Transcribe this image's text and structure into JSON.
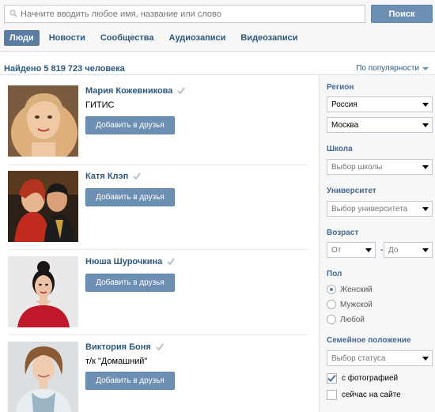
{
  "search": {
    "placeholder": "Начните вводить любое имя, название или слово",
    "button_label": "Поиск"
  },
  "tabs": [
    {
      "label": "Люди",
      "active": true
    },
    {
      "label": "Новости",
      "active": false
    },
    {
      "label": "Сообщества",
      "active": false
    },
    {
      "label": "Аудиозаписи",
      "active": false
    },
    {
      "label": "Видеозаписи",
      "active": false
    }
  ],
  "results_header": {
    "found": "Найдено 5 819 723 человека",
    "sort_label": "По популярности"
  },
  "people": [
    {
      "name": "Мария Кожевникова",
      "subtitle": "ГИТИС",
      "button": "Добавить в друзья"
    },
    {
      "name": "Катя Клэп",
      "subtitle": "",
      "button": "Добавить в друзья"
    },
    {
      "name": "Нюша Шурочкина",
      "subtitle": "",
      "button": "Добавить в друзья"
    },
    {
      "name": "Виктория Боня",
      "subtitle": "т/к \"Домашний\"",
      "button": "Добавить в друзья"
    }
  ],
  "filters": {
    "region_label": "Регион",
    "country": "Россия",
    "city": "Москва",
    "school_label": "Школа",
    "school_placeholder": "Выбор школы",
    "university_label": "Университет",
    "university_placeholder": "Выбор университета",
    "age_label": "Возраст",
    "age_from": "От",
    "age_to": "До",
    "age_dash": "-",
    "gender_label": "Пол",
    "gender_options": [
      {
        "label": "Женский",
        "selected": true
      },
      {
        "label": "Мужской",
        "selected": false
      },
      {
        "label": "Любой",
        "selected": false
      }
    ],
    "marital_label": "Семейное положение",
    "marital_placeholder": "Выбор статуса",
    "with_photo": {
      "label": "с фотографией",
      "checked": true
    },
    "online_now": {
      "label": "сейчас на сайте",
      "checked": false
    }
  },
  "colors": {
    "accent": "#597da3",
    "link": "#2b587a",
    "button": "#6d8fb3"
  }
}
